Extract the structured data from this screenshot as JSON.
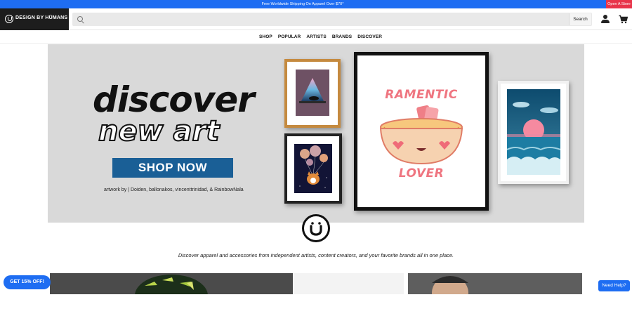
{
  "top_bar": {
    "promo_text": "Free Worldwide Shipping On Apparel Over $70*",
    "open_store_label": "Open A Store",
    "color": "#1e6df2",
    "open_store_color": "#e8344a"
  },
  "header": {
    "logo_text": "DESIGN BY HŪMANS",
    "search": {
      "placeholder": "",
      "button_label": "Search"
    },
    "icons": [
      "user-icon",
      "cart-icon",
      "search-icon"
    ]
  },
  "nav": {
    "items": [
      {
        "label": "SHOP"
      },
      {
        "label": "POPULAR"
      },
      {
        "label": "ARTISTS"
      },
      {
        "label": "BRANDS"
      },
      {
        "label": "DISCOVER"
      }
    ]
  },
  "hero": {
    "headline_1": "discover",
    "headline_2": "new art",
    "cta_label": "SHOP NOW",
    "credit": "artwork by | Doiden, ballonakos, vincenttrinidad, & RainbowNala",
    "cta_color": "#1a5f96",
    "frames": {
      "ramen_title": "RAMENTIC",
      "ramen_subtitle": "LOVER"
    }
  },
  "tagline": "Discover apparel and accessories from independent artists, content creators, and your favorite brands all in one place.",
  "floating": {
    "promo_label": "GET 15% OFF!",
    "help_label": "Need Help?"
  }
}
